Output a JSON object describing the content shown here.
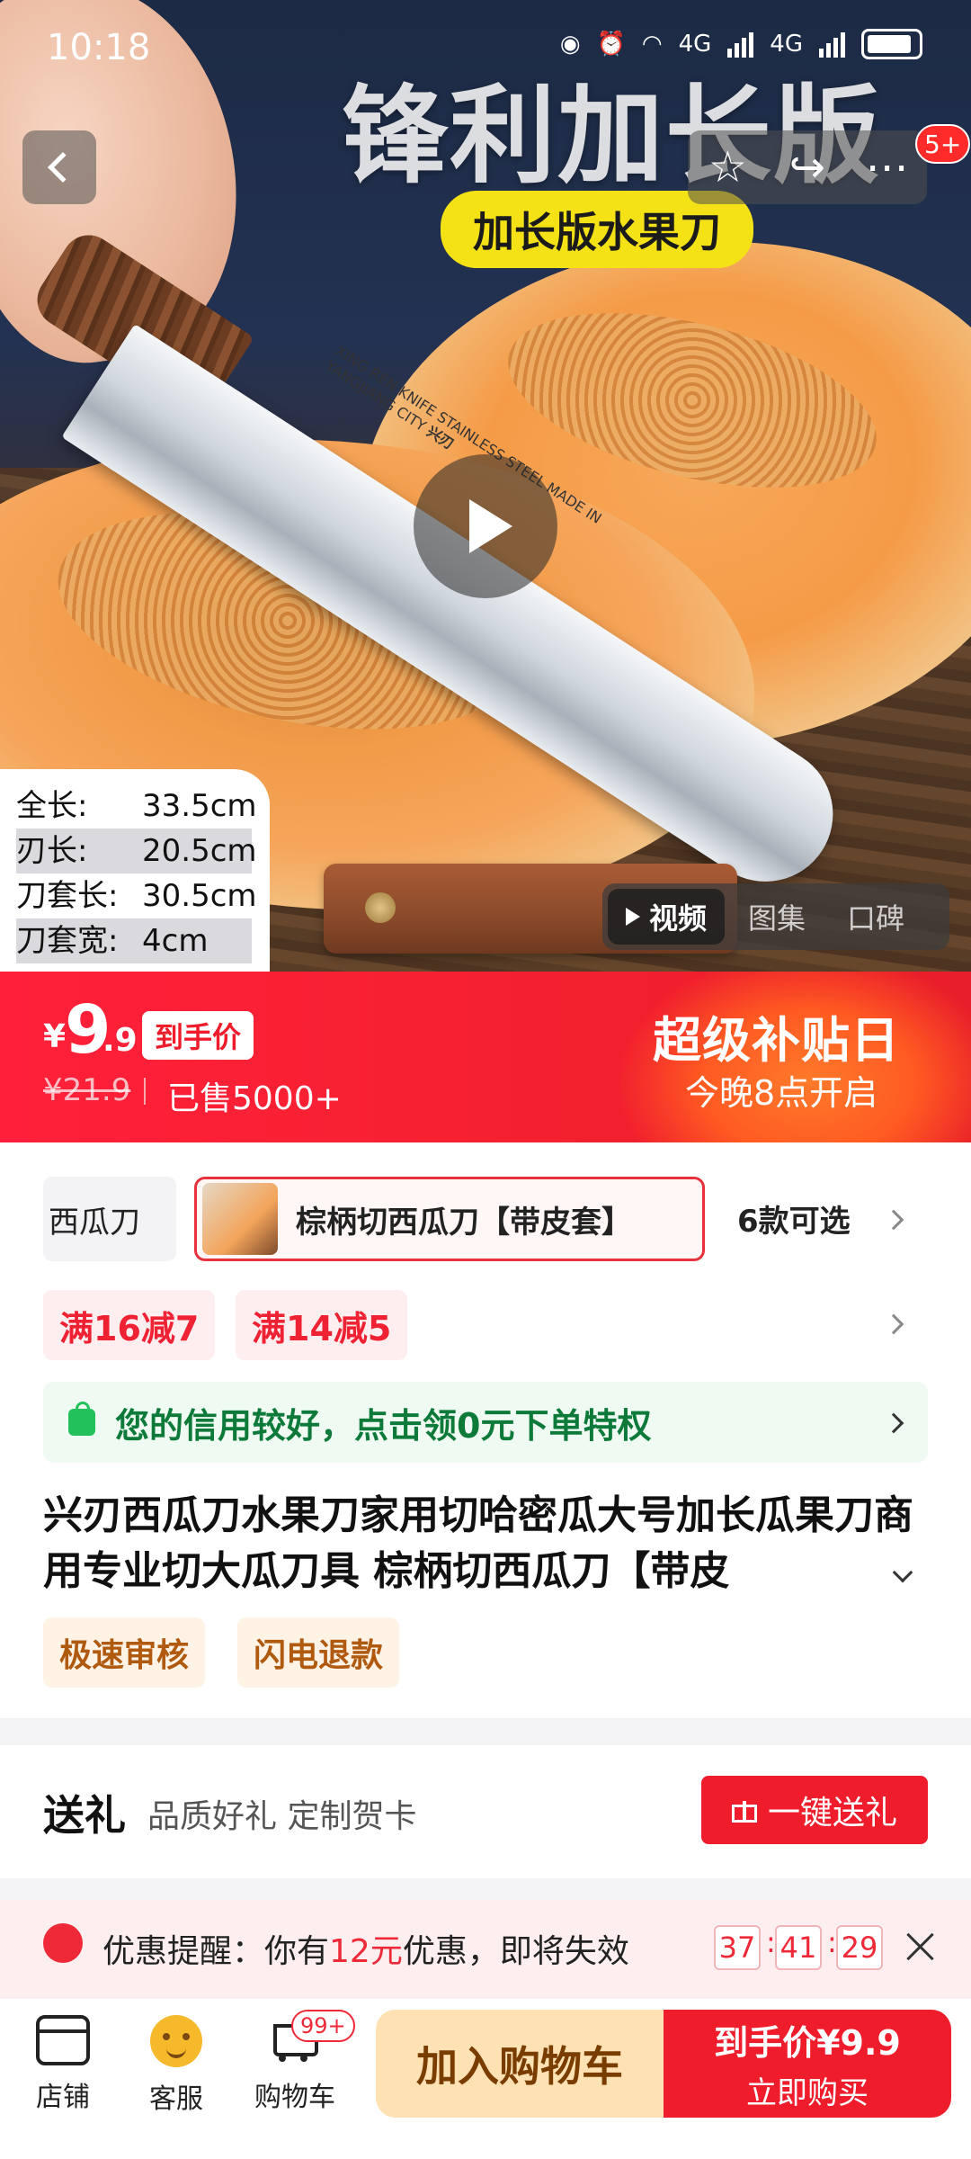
{
  "status_bar": {
    "time": "10:18",
    "net1": "4G",
    "net2": "4G"
  },
  "hero": {
    "title": "锋利加长版",
    "subtitle": "加长版水果刀",
    "blade_brand": "兴刃",
    "blade_text": "XING REN KNIFE STAINLESS STEEL MADE IN YANGJIANG CITY",
    "specs": [
      {
        "k": "全长:",
        "v": "33.5cm"
      },
      {
        "k": "刃长:",
        "v": "20.5cm"
      },
      {
        "k": "刀套长:",
        "v": "30.5cm"
      },
      {
        "k": "刀套宽:",
        "v": "4cm"
      }
    ],
    "media_tabs": [
      "视频",
      "图集",
      "口碑"
    ],
    "badge": "5+"
  },
  "price": {
    "currency": "¥",
    "integer": "9",
    "decimal": ".9",
    "tag": "到手价",
    "original": "¥21.9",
    "sold": "已售5000+",
    "event_title": "超级补贴日",
    "event_sub": "今晚8点开启"
  },
  "sku": {
    "prev": "西瓜刀",
    "selected": "棕柄切西瓜刀【带皮套】",
    "more": "6款可选"
  },
  "coupons": [
    "满16减7",
    "满14减5"
  ],
  "credit": "您的信用较好，点击领0元下单特权",
  "product_title": "兴刃西瓜刀水果刀家用切哈密瓜大号加长瓜果刀商用专业切大瓜刀具 棕柄切西瓜刀【带皮",
  "services": [
    "极速审核",
    "闪电退款"
  ],
  "gift": {
    "title": "送礼",
    "desc": "品质好礼 定制贺卡",
    "button": "一键送礼"
  },
  "promo": {
    "prefix": "优惠提醒：你有",
    "amount": "12元",
    "suffix": "优惠，即将失效",
    "countdown": [
      "37",
      "41",
      "29"
    ]
  },
  "bottom_bar": {
    "shop": "店铺",
    "service": "客服",
    "cart": "购物车",
    "cart_badge": "99+",
    "add_cart": "加入购物车",
    "buy_price": "到手价¥9.9",
    "buy_label": "立即购买"
  }
}
